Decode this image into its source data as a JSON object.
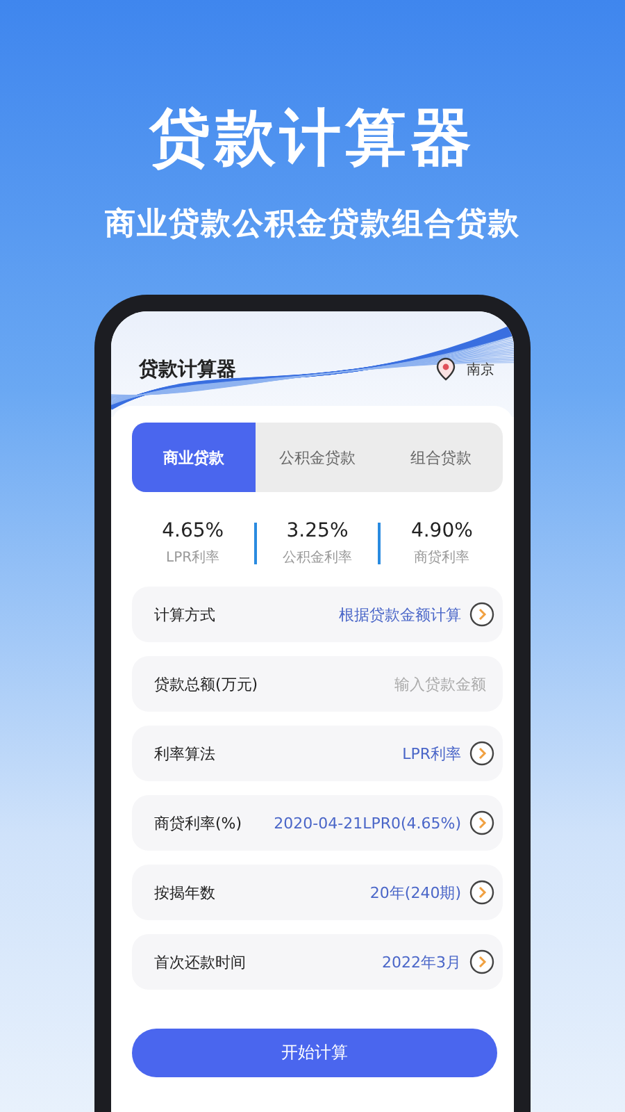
{
  "headline": "贷款计算器",
  "subheadline": "商业贷款公积金贷款组合贷款",
  "app": {
    "title": "贷款计算器",
    "city": "南京"
  },
  "tabs": [
    {
      "label": "商业贷款",
      "selected": true
    },
    {
      "label": "公积金贷款",
      "selected": false
    },
    {
      "label": "组合贷款",
      "selected": false
    }
  ],
  "rates": [
    {
      "value": "4.65%",
      "label": "LPR利率"
    },
    {
      "value": "3.25%",
      "label": "公积金利率"
    },
    {
      "value": "4.90%",
      "label": "商贷利率"
    }
  ],
  "form_rows": [
    {
      "kind": "select",
      "label": "计算方式",
      "value": "根据贷款金额计算"
    },
    {
      "kind": "input",
      "label": "贷款总额(万元)",
      "placeholder": "输入贷款金额"
    },
    {
      "kind": "select",
      "label": "利率算法",
      "value": "LPR利率"
    },
    {
      "kind": "select",
      "label": "商贷利率(%)",
      "value": "2020-04-21LPR0(4.65%)"
    },
    {
      "kind": "select",
      "label": "按揭年数",
      "value": "20年(240期)"
    },
    {
      "kind": "select",
      "label": "首次还款时间",
      "value": "2022年3月"
    }
  ],
  "button": "开始计算"
}
